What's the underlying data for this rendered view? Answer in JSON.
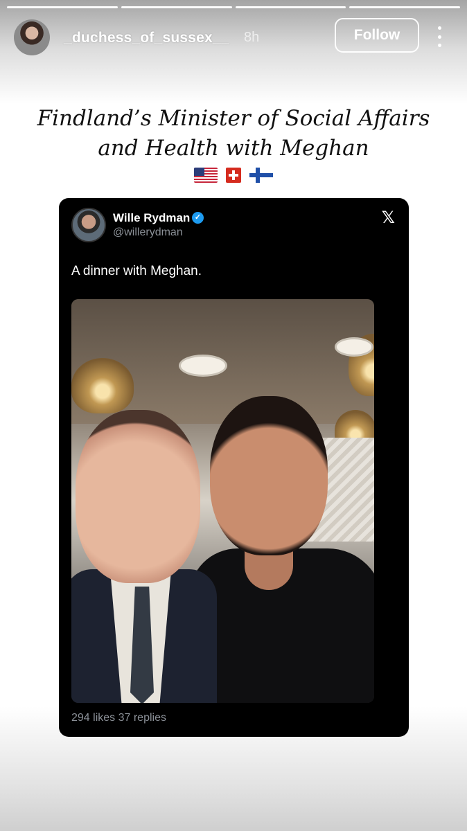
{
  "story": {
    "segments": 4,
    "username": "_duchess_of_sussex__",
    "timestamp": "8h",
    "follow_label": "Follow",
    "more_icon": "more-vertical-icon"
  },
  "caption": {
    "line1": "Findland’s Minister of Social Affairs",
    "line2": "and Health with Meghan",
    "flags": [
      "flag-us-icon",
      "flag-ch-icon",
      "flag-fi-icon"
    ]
  },
  "tweet": {
    "name": "Wille Rydman",
    "verified_icon": "verified-badge-icon",
    "handle": "@willerydman",
    "platform_icon": "x-logo-icon",
    "text": "A dinner with Meghan.",
    "stats": "294 likes  37 replies"
  },
  "colors": {
    "tweet_bg": "#000000",
    "verified": "#1d9bf0",
    "muted": "#8b9097"
  }
}
